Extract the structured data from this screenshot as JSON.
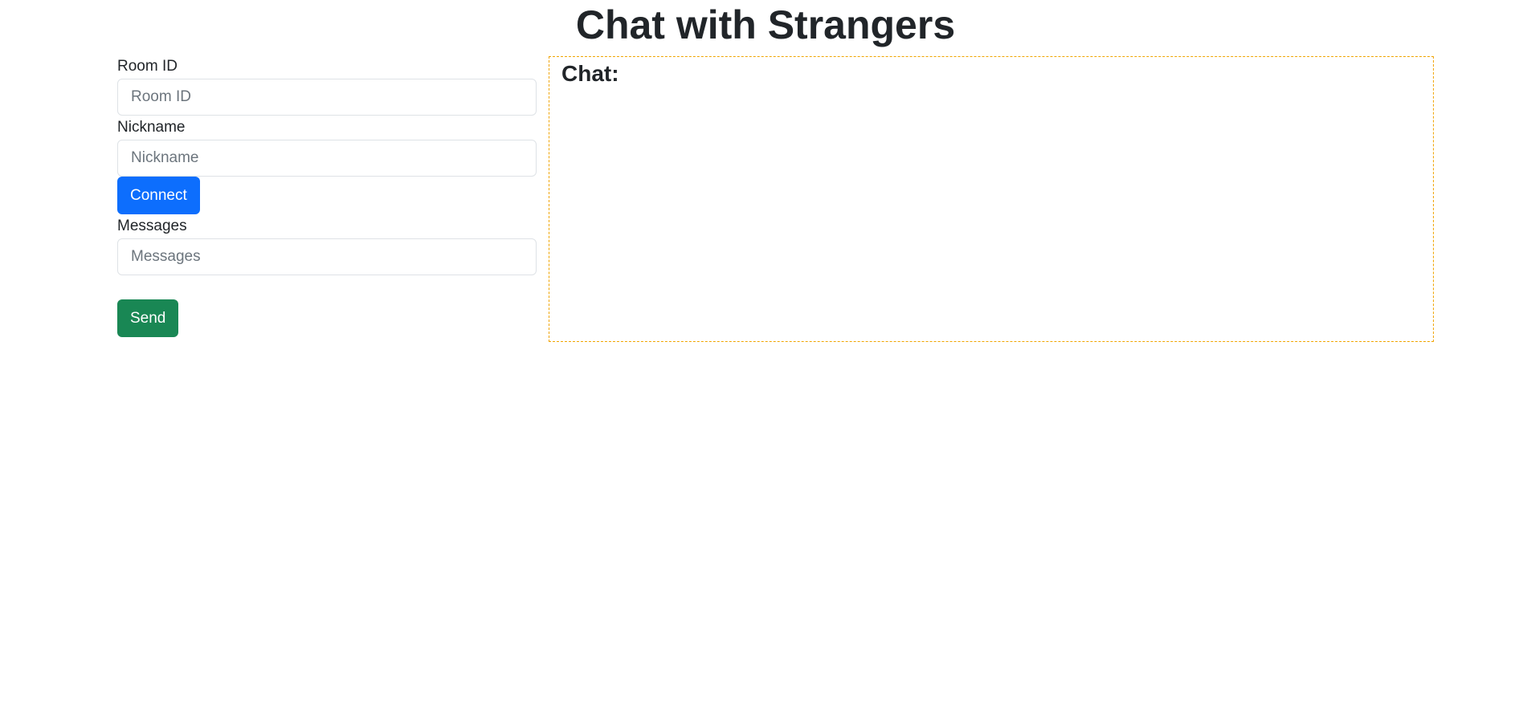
{
  "header": {
    "title": "Chat with Strangers"
  },
  "form": {
    "room_id": {
      "label": "Room ID",
      "placeholder": "Room ID",
      "value": ""
    },
    "nickname": {
      "label": "Nickname",
      "placeholder": "Nickname",
      "value": ""
    },
    "connect_label": "Connect",
    "messages": {
      "label": "Messages",
      "placeholder": "Messages",
      "value": ""
    },
    "send_label": "Send"
  },
  "chat": {
    "heading": "Chat:",
    "messages": []
  },
  "colors": {
    "primary": "#0d6efd",
    "success": "#198754",
    "chat_border": "#f0a500",
    "text": "#212529"
  }
}
